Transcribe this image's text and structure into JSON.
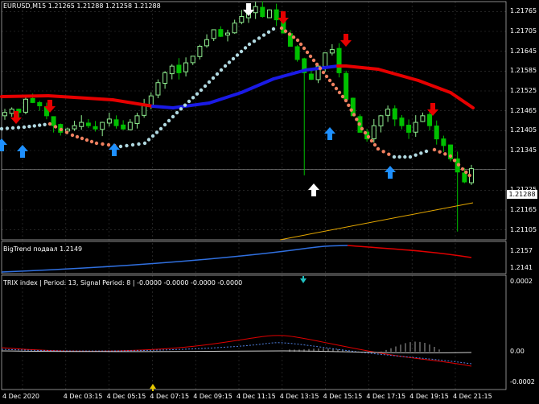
{
  "main_header": "EURUSD,M15  1.21265 1.21288 1.21258 1.21288",
  "current_price": "1.21288",
  "main_yticks": [
    "1.21765",
    "1.21705",
    "1.21645",
    "1.21585",
    "1.21525",
    "1.21465",
    "1.21405",
    "1.21345",
    "1.21288",
    "1.21225",
    "1.21165",
    "1.21105"
  ],
  "big_trend": {
    "label": "BigTrend подвал 1.2149",
    "yticks": [
      "1.2157",
      "1.2141"
    ]
  },
  "trix": {
    "label": "TRIX index | Period: 13, Signal Period: 8 | -0.0000 -0.0000 -0.0000 -0.0000",
    "yticks": [
      "0.0002",
      "0.00",
      "-0.0002"
    ]
  },
  "xticks": [
    "4 Dec 2020",
    "4 Dec 03:15",
    "4 Dec 05:15",
    "4 Dec 07:15",
    "4 Dec 09:15",
    "4 Dec 11:15",
    "4 Dec 13:15",
    "4 Dec 15:15",
    "4 Dec 17:15",
    "4 Dec 19:15",
    "4 Dec 21:15"
  ],
  "colors": {
    "background": "#000000",
    "bull_candle": "#90ee90",
    "bear_candle": "#00c000",
    "trend_up": "#1a1ae6",
    "trend_down": "#e60000",
    "dots_up": "#b0d8e0",
    "dots_down": "#f08060",
    "arrow_buy": "#1e90ff",
    "arrow_sell": "#e60000",
    "arrow_white": "#ffffff",
    "channel_line": "#e6a800"
  },
  "chart_data": {
    "type": "candlestick",
    "symbol": "EURUSD",
    "timeframe": "M15",
    "ylim": [
      1.21075,
      1.21795
    ],
    "closes": [
      1.2146,
      1.2147,
      1.2146,
      1.215,
      1.2149,
      1.2148,
      1.2145,
      1.2142,
      1.214,
      1.2141,
      1.2142,
      1.2143,
      1.2142,
      1.2141,
      1.2143,
      1.2144,
      1.2142,
      1.2141,
      1.2143,
      1.2145,
      1.2148,
      1.2151,
      1.2155,
      1.2158,
      1.216,
      1.2158,
      1.2161,
      1.2163,
      1.2166,
      1.2168,
      1.2171,
      1.2169,
      1.217,
      1.2173,
      1.2175,
      1.2176,
      1.2178,
      1.2175,
      1.2177,
      1.2174,
      1.217,
      1.2166,
      1.2162,
      1.2158,
      1.2156,
      1.216,
      1.2164,
      1.2165,
      1.2158,
      1.215,
      1.2145,
      1.214,
      1.2138,
      1.2142,
      1.2145,
      1.2147,
      1.2144,
      1.2142,
      1.214,
      1.2143,
      1.2145,
      1.2142,
      1.2138,
      1.2136,
      1.2132,
      1.2128,
      1.2125,
      1.2129
    ]
  }
}
